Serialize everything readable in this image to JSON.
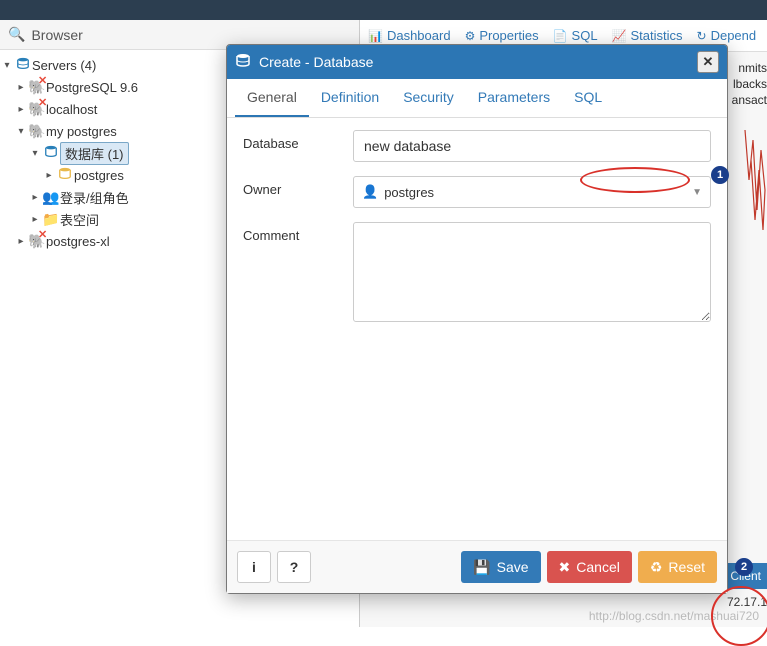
{
  "browser": {
    "title": "Browser",
    "tree": {
      "root": "Servers (4)",
      "pg96": "PostgreSQL 9.6",
      "localhost": "localhost",
      "mypg": "my postgres",
      "dbgroup": "数据库 (1)",
      "postgres_db": "postgres",
      "roles": "登录/组角色",
      "tablespaces": "表空间",
      "pgxl": "postgres-xl"
    }
  },
  "top_tabs": {
    "dashboard": "Dashboard",
    "properties": "Properties",
    "sql": "SQL",
    "statistics": "Statistics",
    "depend": "Depend"
  },
  "side_text": {
    "l1": "nmits",
    "l2": "lbacks",
    "l3": "ansact"
  },
  "client_button": "Client",
  "ip_fragment": "72.17.1",
  "watermark": "http://blog.csdn.net/mashuai720",
  "modal": {
    "title": "Create - Database",
    "tabs": {
      "general": "General",
      "definition": "Definition",
      "security": "Security",
      "parameters": "Parameters",
      "sql": "SQL"
    },
    "labels": {
      "database": "Database",
      "owner": "Owner",
      "comment": "Comment"
    },
    "values": {
      "database": "new database",
      "owner": "postgres",
      "comment": ""
    },
    "buttons": {
      "save": "Save",
      "cancel": "Cancel",
      "reset": "Reset",
      "info": "i",
      "help": "?"
    }
  },
  "annotations": {
    "n1": "1",
    "n2": "2"
  }
}
